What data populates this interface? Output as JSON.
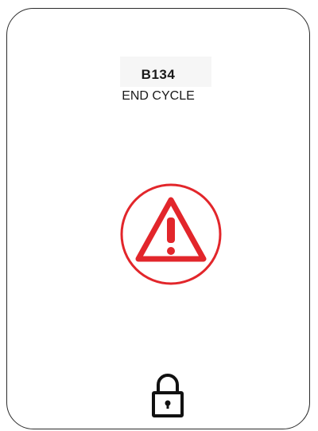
{
  "panel": {
    "code": "B134",
    "message": "END CYCLE"
  },
  "icons": {
    "warning": "warning-triangle-icon",
    "lock": "lock-icon"
  },
  "colors": {
    "alert": "#e2262b",
    "text": "#1a1a1a",
    "border": "#2b2b2b"
  }
}
